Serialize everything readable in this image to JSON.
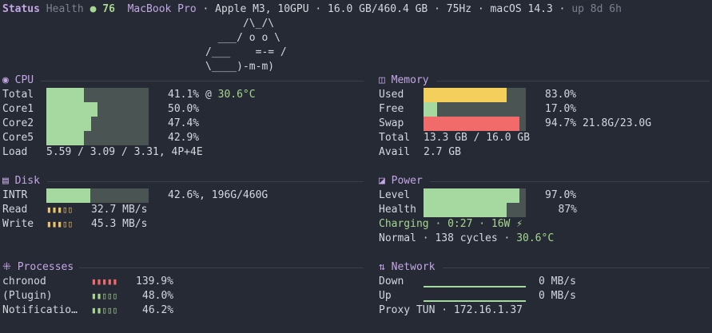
{
  "header": {
    "status": "Status",
    "health_label": "Health",
    "health_dot": "●",
    "health_value": "76",
    "model": "MacBook Pro",
    "sep": " · ",
    "chip": "Apple M3, 10GPU",
    "memory": "16.0 GB/460.4 GB",
    "refresh": "75Hz",
    "os": "macOS 14.3",
    "uptime": "up 8d 6h"
  },
  "ascii": [
    "      /\\_/\\",
    "  ___/ o o \\",
    "/___    =-= /",
    "\\____)-m-m)"
  ],
  "cpu": {
    "icon": "◉",
    "title": "CPU",
    "rows": [
      {
        "label": "Total",
        "percent": 41.1,
        "text": "41.1% @ ",
        "temp": "30.6°C",
        "level": 0.37
      },
      {
        "label": "Core1",
        "percent": 50.0,
        "text": "50.0%",
        "level": 0.5
      },
      {
        "label": "Core2",
        "percent": 47.4,
        "text": "47.4%",
        "level": 0.44
      },
      {
        "label": "Core5",
        "percent": 42.9,
        "text": "42.9%",
        "level": 0.37
      }
    ],
    "load_label": "Load",
    "load_value": "5.59 / 3.09 / 3.31, 4P+4E"
  },
  "memory": {
    "icon": "◫",
    "title": "Memory",
    "rows": [
      {
        "label": "Used",
        "text": "83.0%",
        "level": 0.81,
        "color": "yellow"
      },
      {
        "label": "Free",
        "text": "17.0%",
        "level": 0.13,
        "color": "green"
      },
      {
        "label": "Swap",
        "text": "94.7% 21.8G/23.0G",
        "level": 0.94,
        "color": "red"
      }
    ],
    "total_label": "Total",
    "total_value": "13.3 GB / 16.0 GB",
    "avail_label": "Avail",
    "avail_value": "2.7 GB"
  },
  "disk": {
    "icon": "▤",
    "title": "Disk",
    "intr_label": "INTR",
    "intr_text": "42.6%, 196G/460G",
    "intr_level": 0.426,
    "read_label": "Read",
    "read_value": "32.7 MB/s",
    "read_ticks": "▮▮▮▯▯",
    "write_label": "Write",
    "write_value": "45.3 MB/s",
    "write_ticks": "▮▮▮▯▯"
  },
  "power": {
    "icon": "◪",
    "title": "Power",
    "level_label": "Level",
    "level_text": "97.0%",
    "level_value": 0.94,
    "health_label": "Health",
    "health_text": "87%",
    "health_value": 0.81,
    "charging": "Charging · 0:27 · 16W ⚡",
    "normal_text": "Normal · 138 cycles · ",
    "temp": "30.6°C"
  },
  "processes": {
    "icon": "⁜",
    "title": "Processes",
    "rows": [
      {
        "name": "chronod",
        "ticks": "▮▮▮▮▮",
        "tick_color": "red",
        "value": "139.9%"
      },
      {
        "name": "(Plugin)",
        "ticks": "▮▮▯▯▯",
        "tick_color": "green",
        "value": "48.0%"
      },
      {
        "name": "Notificatio…",
        "ticks": "▮▮▯▯▯",
        "tick_color": "green",
        "value": "46.2%"
      }
    ]
  },
  "network": {
    "icon": "⇅",
    "title": "Network",
    "down_label": "Down",
    "down_value": "0 MB/s",
    "up_label": "Up",
    "up_value": "0 MB/s",
    "proxy": "Proxy TUN · 172.16.1.37"
  }
}
